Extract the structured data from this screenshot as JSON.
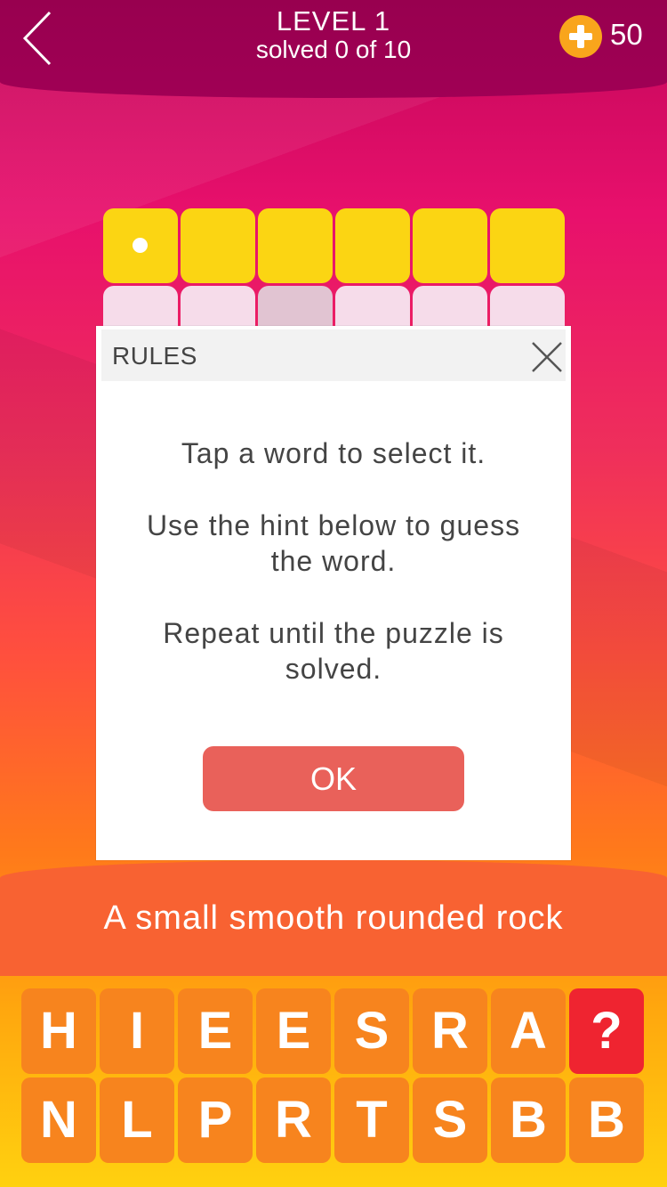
{
  "header": {
    "level_title": "LEVEL 1",
    "progress": "solved 0 of 10",
    "coins": "50"
  },
  "icons": {
    "back": "chevron-left-icon",
    "coin": "plus-coin-icon",
    "close": "close-icon"
  },
  "modal": {
    "title": "RULES",
    "line1": "Tap a word to select it.",
    "line2a": "Use the hint below to guess",
    "line2b": "the word.",
    "line3a": "Repeat until the puzzle is",
    "line3b": "solved.",
    "ok_label": "OK"
  },
  "hint": "A small smooth rounded rock",
  "letters_row1": [
    "H",
    "I",
    "E",
    "E",
    "S",
    "R",
    "A",
    "?"
  ],
  "letters_row2": [
    "N",
    "L",
    "P",
    "R",
    "T",
    "S",
    "B",
    "B"
  ],
  "colors": {
    "active_cell": "#fbd513",
    "tile": "#f7841e",
    "help_tile": "#ef2430",
    "ok_button": "#e9615a"
  }
}
